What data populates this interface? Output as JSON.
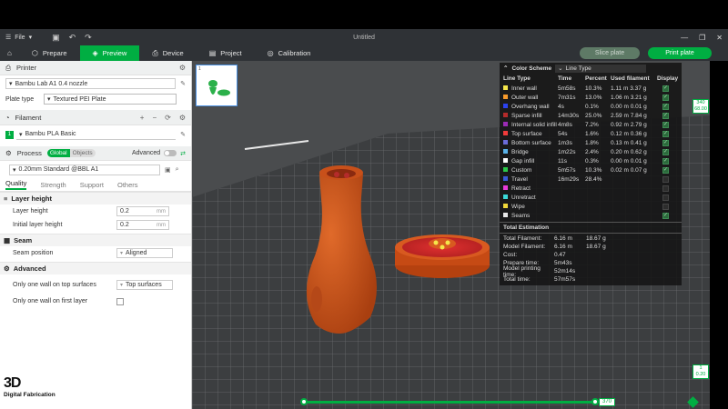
{
  "titlebar": {
    "file_menu": "File",
    "window_title": "Untitled"
  },
  "tabs": [
    {
      "label": "Prepare"
    },
    {
      "label": "Preview"
    },
    {
      "label": "Device"
    },
    {
      "label": "Project"
    },
    {
      "label": "Calibration"
    }
  ],
  "actions": {
    "slice": "Slice plate",
    "print": "Print plate"
  },
  "printer": {
    "header": "Printer",
    "name": "Bambu Lab A1 0.4 nozzle",
    "plate_type_label": "Plate type",
    "plate_type": "Textured PEI Plate"
  },
  "filament": {
    "header": "Filament",
    "index": "1",
    "name": "Bambu PLA Basic"
  },
  "process": {
    "header": "Process",
    "global": "Global",
    "objects": "Objects",
    "advanced": "Advanced",
    "profile": "0.20mm Standard @BBL A1",
    "subtabs": [
      "Quality",
      "Strength",
      "Support",
      "Others"
    ]
  },
  "settings": {
    "layer_height_group": "Layer height",
    "layer_height_label": "Layer height",
    "layer_height": "0.2",
    "initial_layer_label": "Initial layer height",
    "initial_layer": "0.2",
    "unit": "mm",
    "seam_group": "Seam",
    "seam_position_label": "Seam position",
    "seam_position": "Aligned",
    "advanced_group": "Advanced",
    "one_wall_top_label": "Only one wall on top surfaces",
    "one_wall_top": "Top surfaces",
    "one_wall_first_label": "Only one wall on first layer"
  },
  "logo": {
    "text": "3D",
    "subtitle": "Digital Fabrication"
  },
  "plate_thumb": {
    "index": "1"
  },
  "legend": {
    "title": "Color Scheme",
    "type": "Line Type",
    "columns": [
      "Line Type",
      "Time",
      "Percent",
      "Used filament",
      "Display"
    ],
    "rows": [
      {
        "name": "Inner wall",
        "color": "#f5e64a",
        "time": "5m58s",
        "percent": "10.3%",
        "len": "1.11 m",
        "weight": "3.37 g",
        "show": true
      },
      {
        "name": "Outer wall",
        "color": "#f89b2b",
        "time": "7m31s",
        "percent": "13.0%",
        "len": "1.06 m",
        "weight": "3.21 g",
        "show": true
      },
      {
        "name": "Overhang wall",
        "color": "#2b42f0",
        "time": "4s",
        "percent": "0.1%",
        "len": "0.00 m",
        "weight": "0.01 g",
        "show": true
      },
      {
        "name": "Sparse infill",
        "color": "#b52b2b",
        "time": "14m30s",
        "percent": "25.0%",
        "len": "2.59 m",
        "weight": "7.84 g",
        "show": true
      },
      {
        "name": "Internal solid infill",
        "color": "#9b2bb5",
        "time": "4m8s",
        "percent": "7.2%",
        "len": "0.92 m",
        "weight": "2.79 g",
        "show": true
      },
      {
        "name": "Top surface",
        "color": "#f03b3b",
        "time": "54s",
        "percent": "1.6%",
        "len": "0.12 m",
        "weight": "0.36 g",
        "show": true
      },
      {
        "name": "Bottom surface",
        "color": "#6b6bd8",
        "time": "1m3s",
        "percent": "1.8%",
        "len": "0.13 m",
        "weight": "0.41 g",
        "show": true
      },
      {
        "name": "Bridge",
        "color": "#5ab2e8",
        "time": "1m22s",
        "percent": "2.4%",
        "len": "0.20 m",
        "weight": "0.62 g",
        "show": true
      },
      {
        "name": "Gap infill",
        "color": "#ffffff",
        "time": "11s",
        "percent": "0.3%",
        "len": "0.00 m",
        "weight": "0.01 g",
        "show": true
      },
      {
        "name": "Custom",
        "color": "#2bc84a",
        "time": "5m57s",
        "percent": "10.3%",
        "len": "0.02 m",
        "weight": "0.07 g",
        "show": true
      },
      {
        "name": "Travel",
        "color": "#3a5ad8",
        "time": "16m29s",
        "percent": "28.4%",
        "len": "",
        "weight": "",
        "show": false
      },
      {
        "name": "Retract",
        "color": "#e83ad8",
        "time": "",
        "percent": "",
        "len": "",
        "weight": "",
        "show": false
      },
      {
        "name": "Unretract",
        "color": "#3ad8d8",
        "time": "",
        "percent": "",
        "len": "",
        "weight": "",
        "show": false
      },
      {
        "name": "Wipe",
        "color": "#f0d83a",
        "time": "",
        "percent": "",
        "len": "",
        "weight": "",
        "show": false
      },
      {
        "name": "Seams",
        "color": "#e8e8e8",
        "time": "",
        "percent": "",
        "len": "",
        "weight": "",
        "show": true
      }
    ],
    "estimation_title": "Total Estimation",
    "estimation": [
      {
        "key": "Total Filament:",
        "v1": "6.16 m",
        "v2": "18.67 g"
      },
      {
        "key": "Model Filament:",
        "v1": "6.16 m",
        "v2": "18.67 g"
      },
      {
        "key": "Cost:",
        "v1": "0.47",
        "v2": ""
      },
      {
        "key": "Prepare time:",
        "v1": "5m43s",
        "v2": ""
      },
      {
        "key": "Model printing time:",
        "v1": "52m14s",
        "v2": ""
      },
      {
        "key": "Total time:",
        "v1": "57m57s",
        "v2": ""
      }
    ]
  },
  "vslider": {
    "top_layer": "340",
    "top_height": "68.00",
    "bottom_layer": "1",
    "bottom_height": "0.20"
  },
  "hslider": {
    "value": "370"
  }
}
